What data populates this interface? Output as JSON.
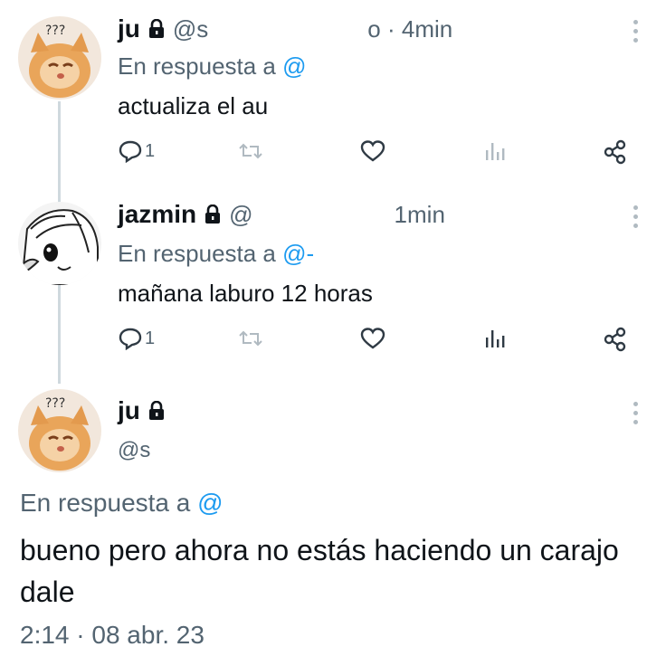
{
  "tweets": [
    {
      "name": "ju",
      "handle": "@s",
      "time": "o · 4min",
      "replying_prefix": "En respuesta a",
      "replying_handle": "@",
      "text": "actualiza el au",
      "replies": "1",
      "avatar_icon": "kitten-avatar-icon"
    },
    {
      "name": "jazmin",
      "handle": "@",
      "time": "1min",
      "replying_prefix": "En respuesta a",
      "replying_handle": "@-",
      "text": "mañana laburo 12 horas",
      "replies": "1",
      "avatar_icon": "anime-avatar-icon"
    }
  ],
  "main_tweet": {
    "name": "ju",
    "handle": "@s",
    "replying_prefix": "En respuesta a",
    "replying_handle": "@",
    "text": "bueno pero ahora no estás haciendo un carajo dale",
    "timestamp": "2:14 · 08 abr. 23"
  },
  "colors": {
    "text": "#0f1419",
    "secondary": "#536471",
    "link": "#1d9bf0",
    "thread_line": "#cfd9de"
  }
}
